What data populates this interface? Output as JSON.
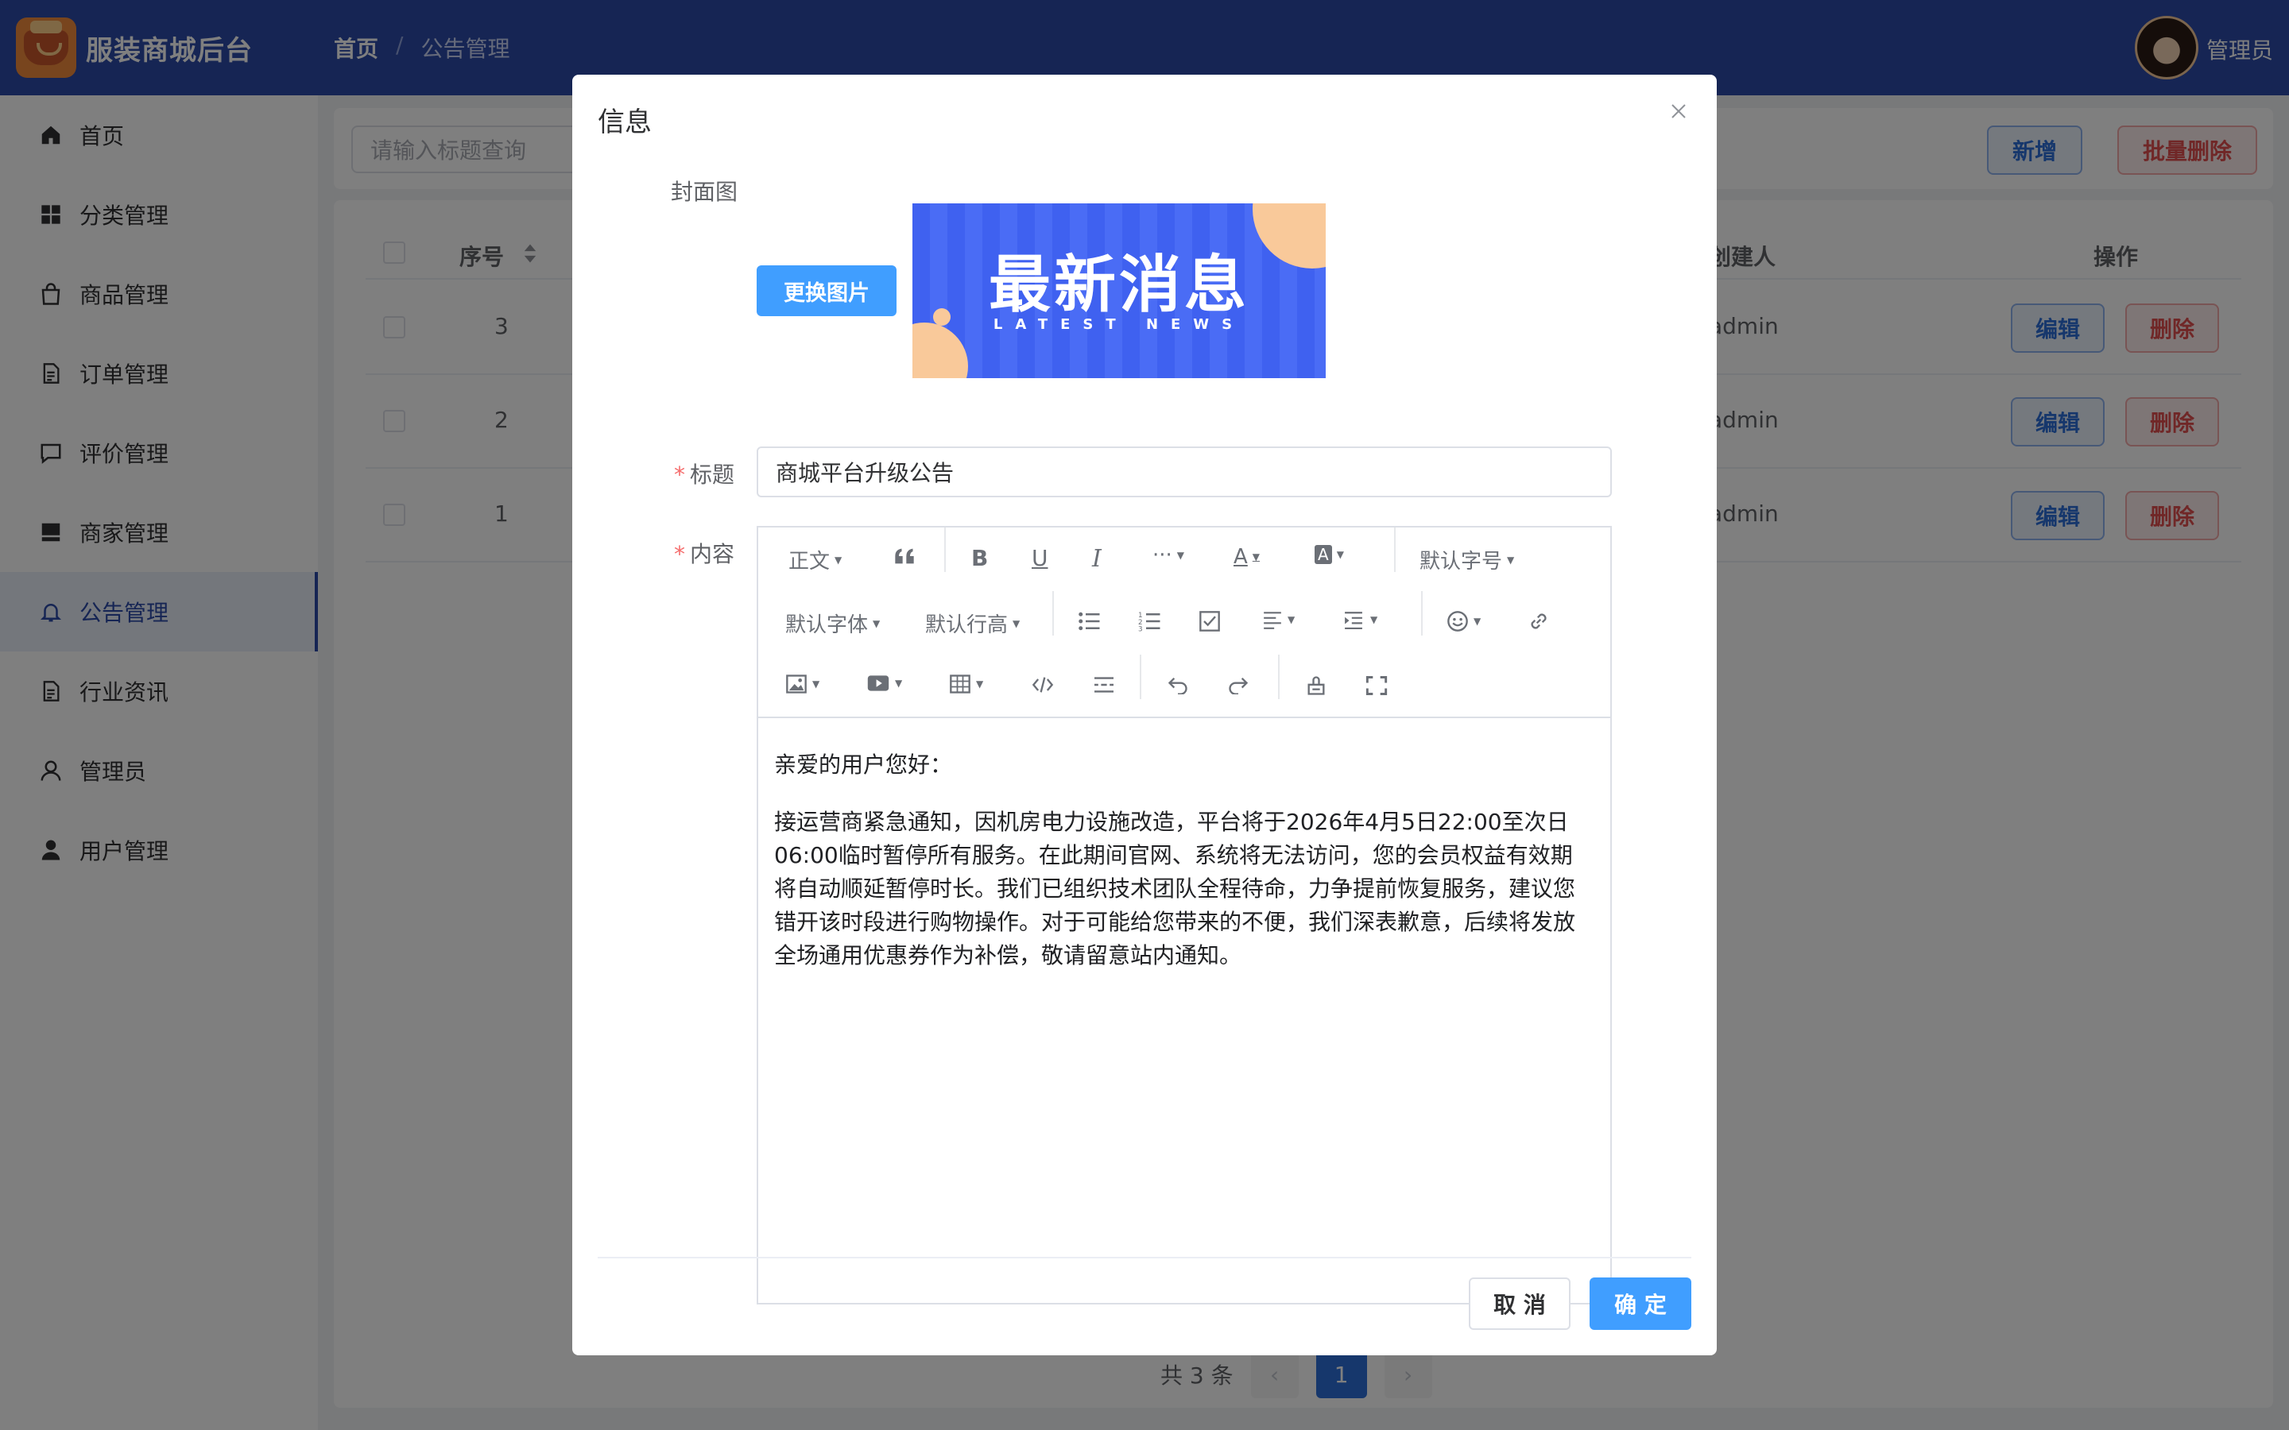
{
  "app": {
    "title": "服装商城后台"
  },
  "breadcrumb": {
    "home": "首页",
    "sep": "/",
    "current": "公告管理"
  },
  "user": {
    "name": "管理员"
  },
  "sidebar": {
    "items": [
      {
        "label": "首页",
        "icon": "home-icon"
      },
      {
        "label": "分类管理",
        "icon": "grid-icon"
      },
      {
        "label": "商品管理",
        "icon": "bag-icon"
      },
      {
        "label": "订单管理",
        "icon": "document-icon"
      },
      {
        "label": "评价管理",
        "icon": "chat-icon"
      },
      {
        "label": "商家管理",
        "icon": "shop-icon"
      },
      {
        "label": "公告管理",
        "icon": "bell-icon"
      },
      {
        "label": "行业资讯",
        "icon": "document-icon"
      },
      {
        "label": "管理员",
        "icon": "user-icon"
      },
      {
        "label": "用户管理",
        "icon": "user-filled-icon"
      }
    ],
    "active_index": 6
  },
  "search": {
    "placeholder": "请输入标题查询"
  },
  "toolbar": {
    "add_label": "新增",
    "batch_delete_label": "批量删除"
  },
  "table": {
    "headers": {
      "index": "序号",
      "creator": "创建人",
      "actions": "操作"
    },
    "rows": [
      {
        "index": "3",
        "creator": "admin"
      },
      {
        "index": "2",
        "creator": "admin"
      },
      {
        "index": "1",
        "creator": "admin"
      }
    ],
    "edit_label": "编辑",
    "delete_label": "删除"
  },
  "pagination": {
    "total_text": "共 3 条",
    "current_page": "1",
    "prev": "‹",
    "next": "›"
  },
  "dialog": {
    "title": "信息",
    "cover_label": "封面图",
    "change_image_label": "更换图片",
    "cover_image": {
      "title": "最新消息",
      "subtitle": "LATEST NEWS"
    },
    "title_label": "标题",
    "title_value": "商城平台升级公告",
    "content_label": "内容",
    "editor_toolbar": {
      "paragraph": "正文",
      "font_size": "默认字号",
      "font_family": "默认字体",
      "line_height": "默认行高"
    },
    "content": {
      "greeting": "亲爱的用户您好：",
      "body": "接运营商紧急通知，因机房电力设施改造，平台将于2026年4月5日22:00至次日06:00临时暂停所有服务。在此期间官网、系统将无法访问，您的会员权益有效期将自动顺延暂停时长。我们已组织技术团队全程待命，力争提前恢复服务，建议您错开该时段进行购物操作。对于可能给您带来的不便，我们深表歉意，后续将发放全场通用优惠券作为补偿，敬请留意站内通知。"
    },
    "cancel_label": "取 消",
    "ok_label": "确 定"
  },
  "colors": {
    "header_bg": "#2c4aa8",
    "primary": "#409eff",
    "danger": "#e04f4f"
  }
}
